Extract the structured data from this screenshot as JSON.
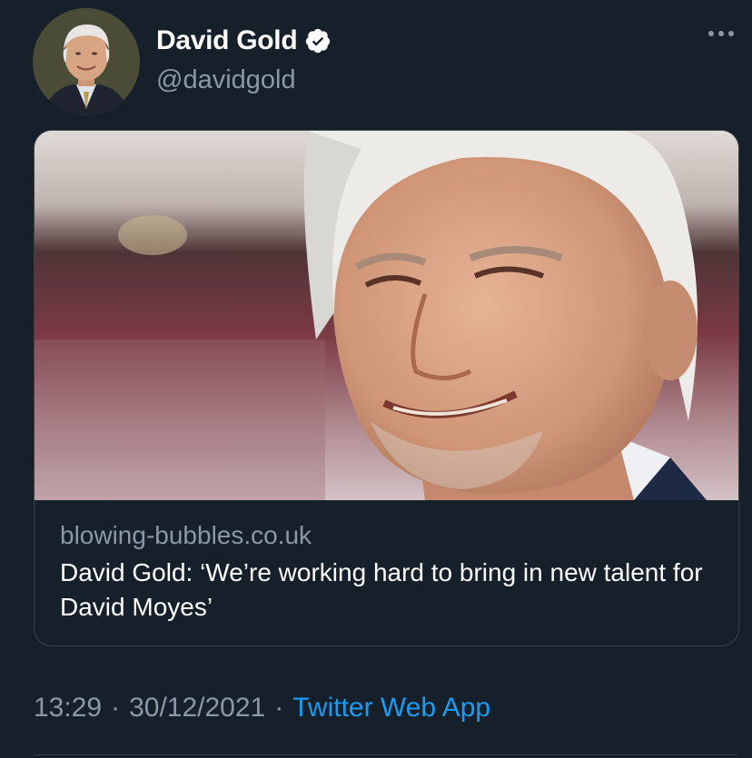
{
  "author": {
    "display_name": "David Gold",
    "handle": "@davidgold",
    "verified": true,
    "avatar_icon": "profile-photo"
  },
  "card": {
    "domain": "blowing-bubbles.co.uk",
    "title": "David Gold: ‘We’re working hard to bring in new talent for David Moyes’"
  },
  "meta": {
    "time": "13:29",
    "separator1": "·",
    "date": "30/12/2021",
    "separator2": "·",
    "source": "Twitter Web App"
  },
  "colors": {
    "background": "#15202b",
    "secondary_text": "#8b98a5",
    "link": "#1d9bf0",
    "verified": "#ffffff"
  }
}
